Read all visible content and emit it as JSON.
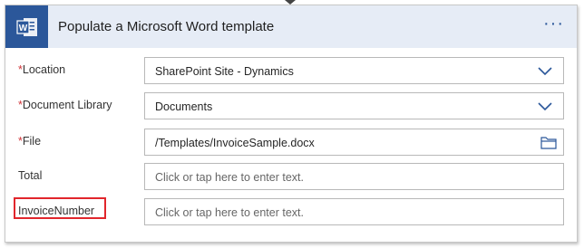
{
  "header": {
    "title": "Populate a Microsoft Word template",
    "more_label": "···"
  },
  "fields": [
    {
      "label": "Location",
      "required": true,
      "value": "SharePoint Site - Dynamics"
    },
    {
      "label": "Document Library",
      "required": true,
      "value": "Documents"
    },
    {
      "label": "File",
      "required": true,
      "value": "/Templates/InvoiceSample.docx"
    },
    {
      "label": "Total",
      "required": false,
      "placeholder": "Click or tap here to enter text."
    },
    {
      "label": "InvoiceNumber",
      "required": false,
      "placeholder": "Click or tap here to enter text."
    }
  ],
  "required_marker": "*",
  "colors": {
    "brand": "#2b579a",
    "header_bg": "#e6ecf6",
    "highlight": "#e1262c",
    "required": "#d13438"
  }
}
